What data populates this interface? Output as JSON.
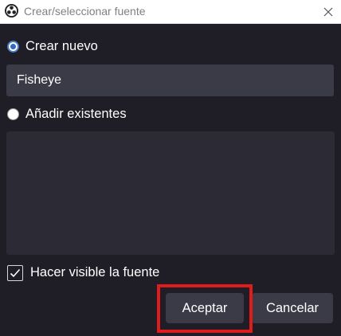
{
  "window": {
    "title": "Crear/seleccionar fuente",
    "logo_icon": "obs-logo-icon",
    "close_icon": "close-icon"
  },
  "options": {
    "create_new_label": "Crear nuevo",
    "create_new_selected": true,
    "add_existing_label": "Añadir existentes",
    "add_existing_selected": false
  },
  "name_field": {
    "value": "Fisheye"
  },
  "existing_sources": [],
  "visible_checkbox": {
    "label": "Hacer visible la fuente",
    "checked": true
  },
  "buttons": {
    "accept_label": "Aceptar",
    "cancel_label": "Cancelar"
  },
  "colors": {
    "background": "#1f1e26",
    "control": "#3b3b47",
    "list_background": "#2b2a35",
    "highlight": "#e01b1b",
    "radio_accent": "#2e6bc4"
  }
}
